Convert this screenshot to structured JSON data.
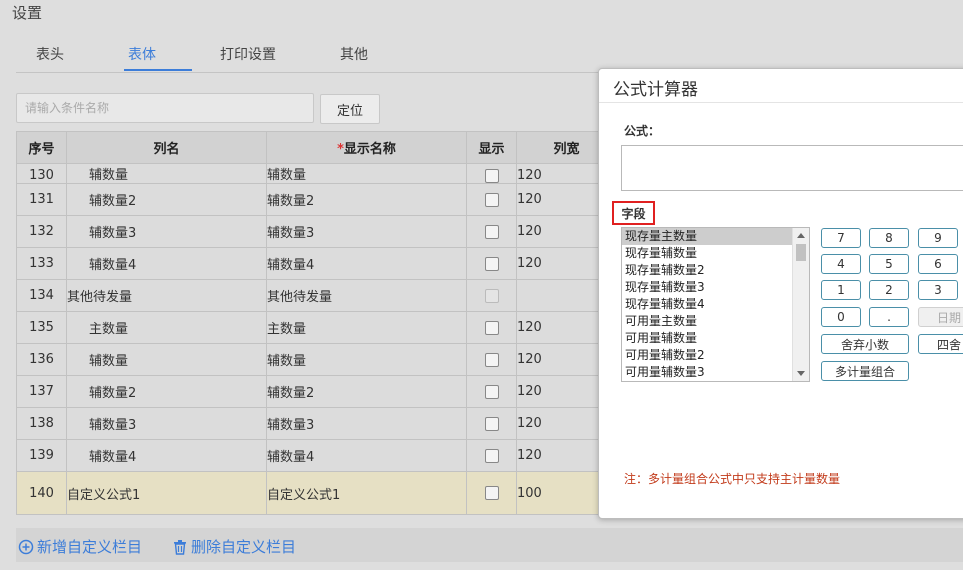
{
  "page": {
    "title": "设置"
  },
  "tabs": [
    "表头",
    "表体",
    "打印设置",
    "其他"
  ],
  "toolbar": {
    "search_placeholder": "请输入条件名称",
    "locate_label": "定位"
  },
  "table": {
    "headers": {
      "seq": "序号",
      "name": "列名",
      "required_mark": "*",
      "display_name": "显示名称",
      "show": "显示",
      "width": "列宽"
    },
    "rows": [
      {
        "seq": "130",
        "name": "辅数量",
        "display": "辅数量",
        "width": "120"
      },
      {
        "seq": "131",
        "name": "辅数量2",
        "display": "辅数量2",
        "width": "120"
      },
      {
        "seq": "132",
        "name": "辅数量3",
        "display": "辅数量3",
        "width": "120"
      },
      {
        "seq": "133",
        "name": "辅数量4",
        "display": "辅数量4",
        "width": "120"
      },
      {
        "seq": "134",
        "name": "其他待发量",
        "display": "其他待发量",
        "width": ""
      },
      {
        "seq": "135",
        "name": "主数量",
        "display": "主数量",
        "width": "120"
      },
      {
        "seq": "136",
        "name": "辅数量",
        "display": "辅数量",
        "width": "120"
      },
      {
        "seq": "137",
        "name": "辅数量2",
        "display": "辅数量2",
        "width": "120"
      },
      {
        "seq": "138",
        "name": "辅数量3",
        "display": "辅数量3",
        "width": "120"
      },
      {
        "seq": "139",
        "name": "辅数量4",
        "display": "辅数量4",
        "width": "120"
      },
      {
        "seq": "140",
        "name": "自定义公式1",
        "display": "自定义公式1",
        "width": "100"
      }
    ]
  },
  "footer": {
    "add_label": "新增自定义栏目",
    "delete_label": "删除自定义栏目"
  },
  "dialog": {
    "title": "公式计算器",
    "formula_label": "公式：",
    "field_label": "字段",
    "fields": [
      "现存量主数量",
      "现存量辅数量",
      "现存量辅数量2",
      "现存量辅数量3",
      "现存量辅数量4",
      "可用量主数量",
      "可用量辅数量",
      "可用量辅数量2",
      "可用量辅数量3"
    ],
    "keys": {
      "k7": "7",
      "k8": "8",
      "k9": "9",
      "k4": "4",
      "k5": "5",
      "k6": "6",
      "k1": "1",
      "k2": "2",
      "k3": "3",
      "k0": "0",
      "dot": ".",
      "date": "日期"
    },
    "btn_truncate": "舍弃小数",
    "btn_round": "四舍",
    "btn_multi": "多计量组合",
    "note": "注：多计量组合公式中只支持主计量数量"
  },
  "colors": {
    "accent": "#3c7dd9",
    "highlight_border": "#e02020",
    "note_text": "#c23a1a",
    "key_border": "#4a8fa8",
    "selected_row": "#e6e0c4"
  }
}
